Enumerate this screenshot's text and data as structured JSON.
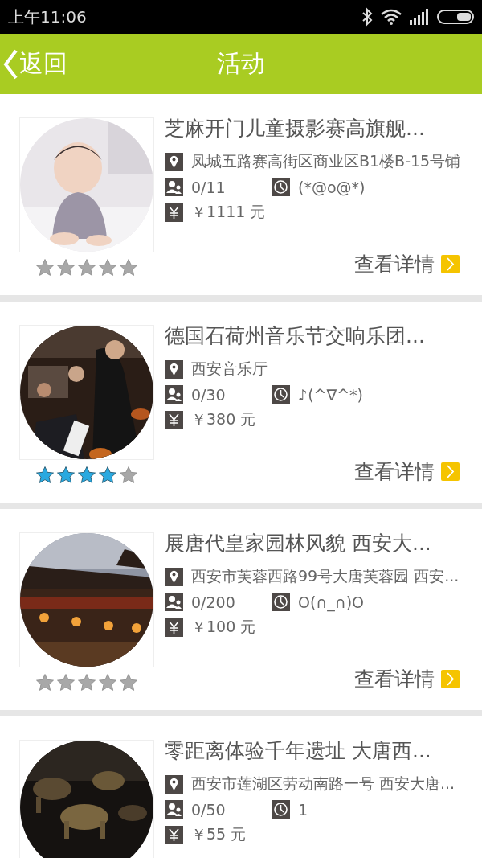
{
  "status_bar": {
    "time": "上午11:06"
  },
  "header": {
    "back": "返回",
    "title": "活动"
  },
  "events": [
    {
      "title": "芝麻开门儿童摄影赛高旗舰...",
      "address": "凤城五路赛高街区商业区B1楼B-15号铺",
      "people": "0/11",
      "time": "(*@o@*)",
      "price": "￥1111 元",
      "stars": 0,
      "detail": "查看详情"
    },
    {
      "title": "德国石荷州音乐节交响乐团...",
      "address": "西安音乐厅",
      "people": "0/30",
      "time": "♪(^∇^*)",
      "price": "￥380 元",
      "stars": 4,
      "detail": "查看详情"
    },
    {
      "title": "展唐代皇家园林风貌 西安大...",
      "address": "西安市芙蓉西路99号大唐芙蓉园 西安...",
      "people": "0/200",
      "time": "O(∩_∩)O",
      "price": "￥100 元",
      "stars": 0,
      "detail": "查看详情"
    },
    {
      "title": "零距离体验千年遗址 大唐西...",
      "address": "西安市莲湖区劳动南路一号 西安大唐...",
      "people": "0/50",
      "time": "1",
      "price": "￥55 元"
    }
  ]
}
